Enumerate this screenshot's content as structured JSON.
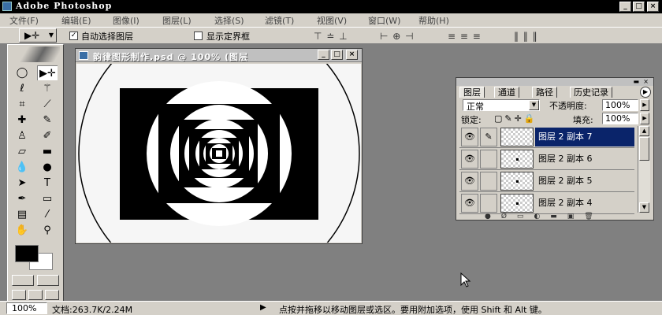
{
  "app": {
    "title": "Adobe Photoshop"
  },
  "menu": {
    "items": [
      "文件(F)",
      "编辑(E)",
      "图像(I)",
      "图层(L)",
      "选择(S)",
      "滤镜(T)",
      "视图(V)",
      "窗口(W)",
      "帮助(H)"
    ]
  },
  "options": {
    "auto_select_label": "自动选择图层",
    "auto_select_checked": "✓",
    "show_bounds_label": "显示定界框"
  },
  "document": {
    "title": "韵律图形制作.psd @ 100% (图层"
  },
  "layers_panel": {
    "tabs": [
      "图层",
      "通道",
      "路径",
      "历史记录"
    ],
    "blend_mode": "正常",
    "opacity_label": "不透明度:",
    "opacity_value": "100%",
    "lock_label": "锁定:",
    "fill_label": "填充:",
    "fill_value": "100%",
    "layers": [
      {
        "name": "图层 2 副本 7",
        "selected": true
      },
      {
        "name": "图层 2 副本 6",
        "selected": false
      },
      {
        "name": "图层 2 副本 5",
        "selected": false
      },
      {
        "name": "图层 2 副本 4",
        "selected": false
      }
    ]
  },
  "status": {
    "zoom": "100%",
    "doc_info": "文档:263.7K/2.24M",
    "hint": "点按并拖移以移动图层或选区。要用附加选项，使用 Shift 和 Alt 键。"
  },
  "colors": {
    "foreground": "#000000",
    "background": "#ffffff",
    "selection": "#0a246a"
  },
  "icons": {
    "move_tool": "move-arrow-icon",
    "eye": "eye-icon",
    "brush_link": "brush-icon"
  }
}
